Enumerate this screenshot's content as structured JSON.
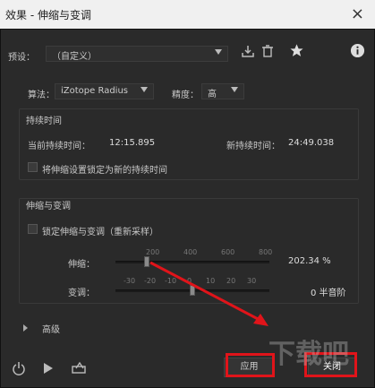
{
  "window": {
    "title": "效果 - 伸缩与变调",
    "close": "×"
  },
  "preset": {
    "label": "预设：",
    "value": "（自定义）"
  },
  "algorithm": {
    "label": "算法：",
    "value": "iZotope Radius"
  },
  "precision": {
    "label": "精度：",
    "value": "高"
  },
  "duration": {
    "title": "持续时间",
    "current_label": "当前持续时间：",
    "current_value": "12:15.895",
    "new_label": "新持续时间：",
    "new_value": "24:49.038",
    "lock_label": "将伸缩设置锁定为新的持续时间"
  },
  "stretch_pitch": {
    "title": "伸缩与变调",
    "lock_label": "锁定伸缩与变调（重新采样）",
    "stretch_label": "伸缩：",
    "stretch_scale": [
      "200",
      "400",
      "600",
      "800"
    ],
    "stretch_value": "202.34 %",
    "stretch_level": 0.202,
    "pitch_label": "变调：",
    "pitch_scale": [
      "-30",
      "-20",
      "-10",
      "0",
      "10",
      "20",
      "30"
    ],
    "pitch_value": "0 半音阶",
    "pitch_level": 0.5
  },
  "advanced": {
    "label": "高级"
  },
  "buttons": {
    "apply": "应用",
    "close": "关闭"
  },
  "icons": [
    "save-preset-icon",
    "delete-preset-icon",
    "favorite-star-icon",
    "info-icon",
    "power-icon",
    "play-icon",
    "export-icon"
  ],
  "colors": {
    "highlight": "#e0141a",
    "panel_bg": "#2a2a2a",
    "titlebar_bg": "#f0f0f0"
  },
  "watermark": "下载吧"
}
